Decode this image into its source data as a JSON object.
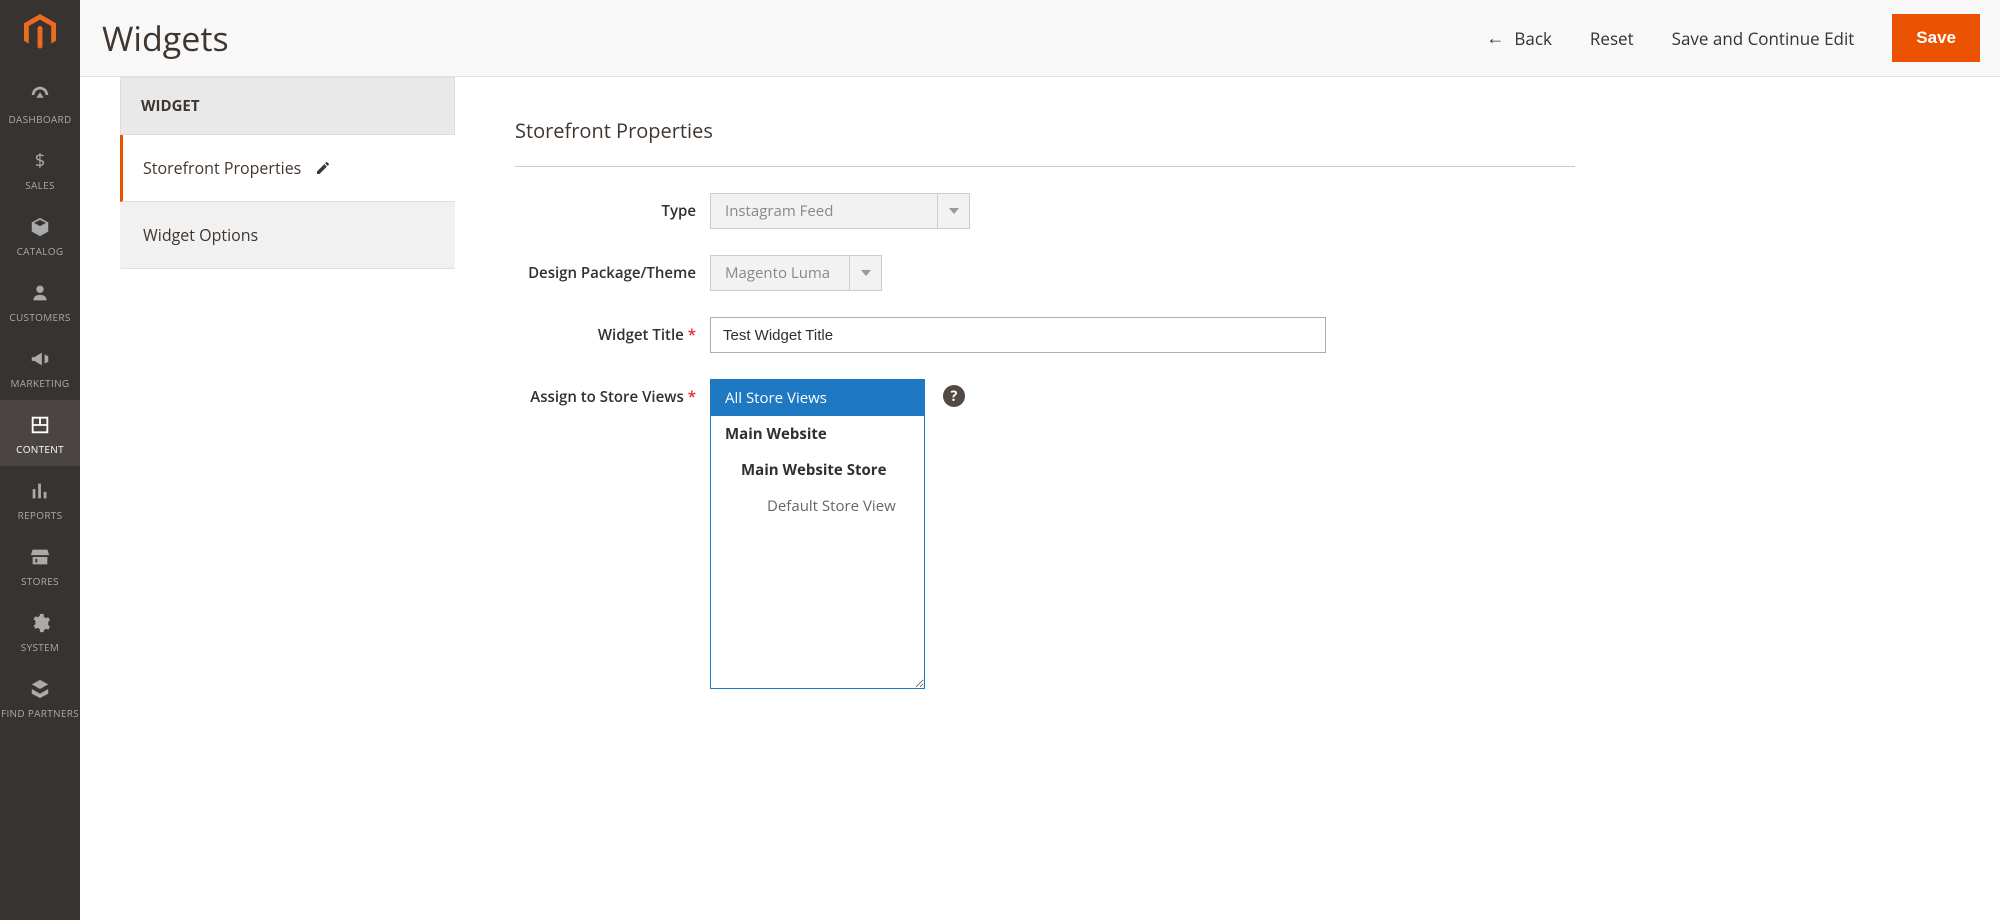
{
  "header": {
    "title": "Widgets",
    "back": "Back",
    "reset": "Reset",
    "save_continue": "Save and Continue Edit",
    "save": "Save"
  },
  "sidebar": {
    "items": [
      {
        "label": "DASHBOARD"
      },
      {
        "label": "SALES"
      },
      {
        "label": "CATALOG"
      },
      {
        "label": "CUSTOMERS"
      },
      {
        "label": "MARKETING"
      },
      {
        "label": "CONTENT"
      },
      {
        "label": "REPORTS"
      },
      {
        "label": "STORES"
      },
      {
        "label": "SYSTEM"
      },
      {
        "label": "FIND PARTNERS"
      }
    ]
  },
  "tabs": {
    "header": "WIDGET",
    "storefront": "Storefront Properties",
    "options": "Widget Options"
  },
  "form": {
    "section_title": "Storefront Properties",
    "type_label": "Type",
    "type_value": "Instagram Feed",
    "theme_label": "Design Package/Theme",
    "theme_value": "Magento Luma",
    "title_label": "Widget Title",
    "title_value": "Test Widget Title",
    "assign_label": "Assign to Store Views",
    "store_views": {
      "all": "All Store Views",
      "main_website": "Main Website",
      "main_store": "Main Website Store",
      "default_view": "Default Store View"
    }
  }
}
